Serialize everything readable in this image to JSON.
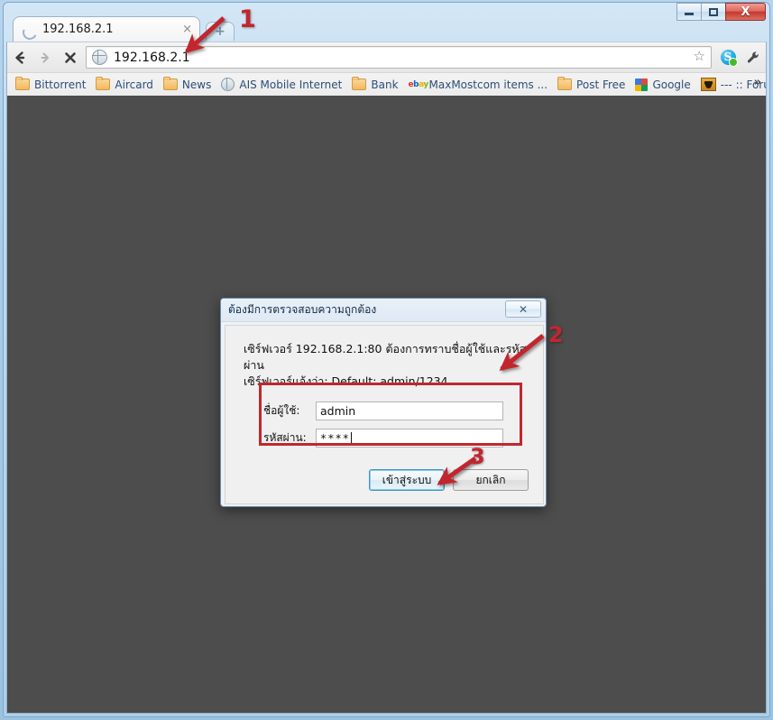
{
  "window": {
    "controls": {
      "minimize_label": "Minimize",
      "maximize_label": "Maximize",
      "close_label": "X"
    }
  },
  "tabstrip": {
    "tab_title": "192.168.2.1",
    "tab_close_label": "×",
    "new_tab_label": "+"
  },
  "toolbar": {
    "back_label": "Back",
    "forward_label": "Forward",
    "stop_label": "Stop",
    "url": "192.168.2.1",
    "star_label": "☆",
    "skype_label": "Skype",
    "wrench_label": "Customize and control"
  },
  "bookmarks": {
    "items": [
      {
        "label": "Bittorrent",
        "icon": "folder-icon"
      },
      {
        "label": "Aircard",
        "icon": "folder-icon"
      },
      {
        "label": "News",
        "icon": "folder-icon"
      },
      {
        "label": "AIS Mobile Internet",
        "icon": "globe-icon"
      },
      {
        "label": "Bank",
        "icon": "folder-icon"
      },
      {
        "label": "MaxMostcom items ...",
        "icon": "ebay-icon"
      },
      {
        "label": "Post Free",
        "icon": "folder-icon"
      },
      {
        "label": "Google",
        "icon": "google-icon"
      },
      {
        "label": "--- :: Forums",
        "icon": "moose-icon"
      }
    ],
    "overflow_label": "»"
  },
  "dialog": {
    "title": "ต้องมีการตรวจสอบความถูกต้อง",
    "close_label": "✕",
    "message_line1": "เซิร์ฟเวอร์ 192.168.2.1:80 ต้องการทราบชื่อผู้ใช้และรหัสผ่าน",
    "message_line2": "เซิร์ฟเวอร์แจ้งว่า: Default: admin/1234",
    "username_label": "ชื่อผู้ใช้:",
    "username_value": "admin",
    "password_label": "รหัสผ่าน:",
    "password_value": "****",
    "login_button": "เข้าสู่ระบบ",
    "cancel_button": "ยกเลิก"
  },
  "annotations": {
    "step1": "1",
    "step2": "2",
    "step3": "3",
    "color": "#c1272d"
  }
}
